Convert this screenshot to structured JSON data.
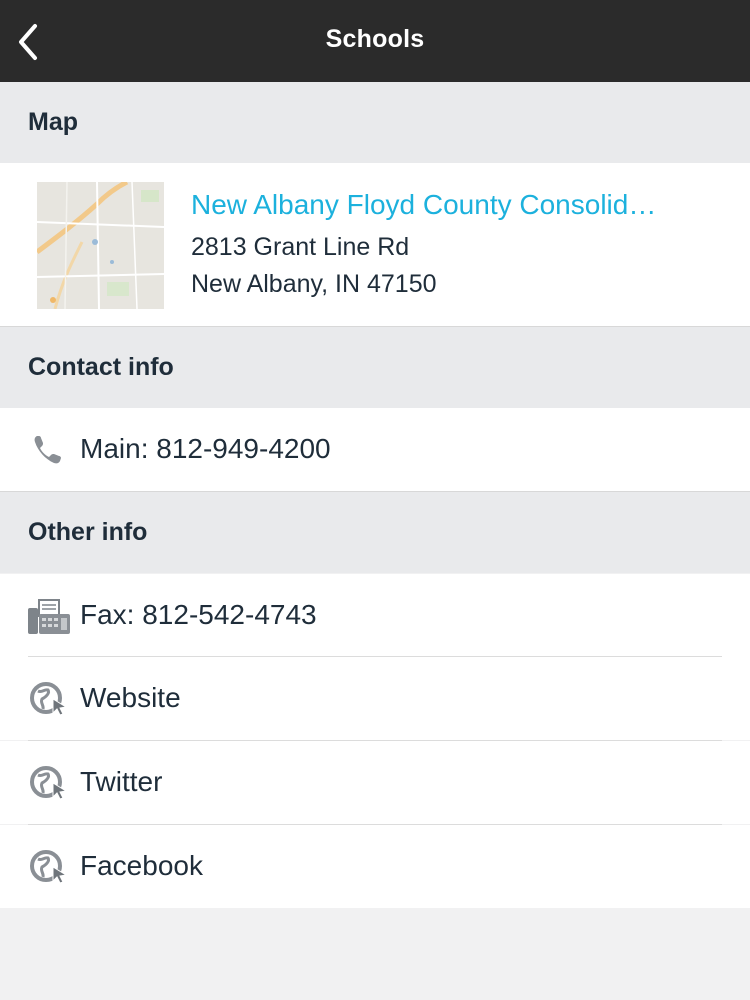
{
  "header": {
    "title": "Schools",
    "back_icon": "chevron-left-icon"
  },
  "sections": {
    "map": "Map",
    "contact": "Contact info",
    "other": "Other info"
  },
  "map_card": {
    "name": "New Albany Floyd County Consolid…",
    "address_line1": "2813 Grant Line Rd",
    "address_line2": "New Albany, IN 47150",
    "accent_color": "#1cb1dd"
  },
  "contact": {
    "phone": {
      "label": "Main: 812-949-4200",
      "icon": "phone-icon"
    }
  },
  "other": {
    "fax": {
      "label": "Fax: 812-542-4743",
      "icon": "fax-icon"
    },
    "links": [
      {
        "label": "Website",
        "icon": "globe-icon"
      },
      {
        "label": "Twitter",
        "icon": "globe-icon"
      },
      {
        "label": "Facebook",
        "icon": "globe-icon"
      }
    ]
  }
}
